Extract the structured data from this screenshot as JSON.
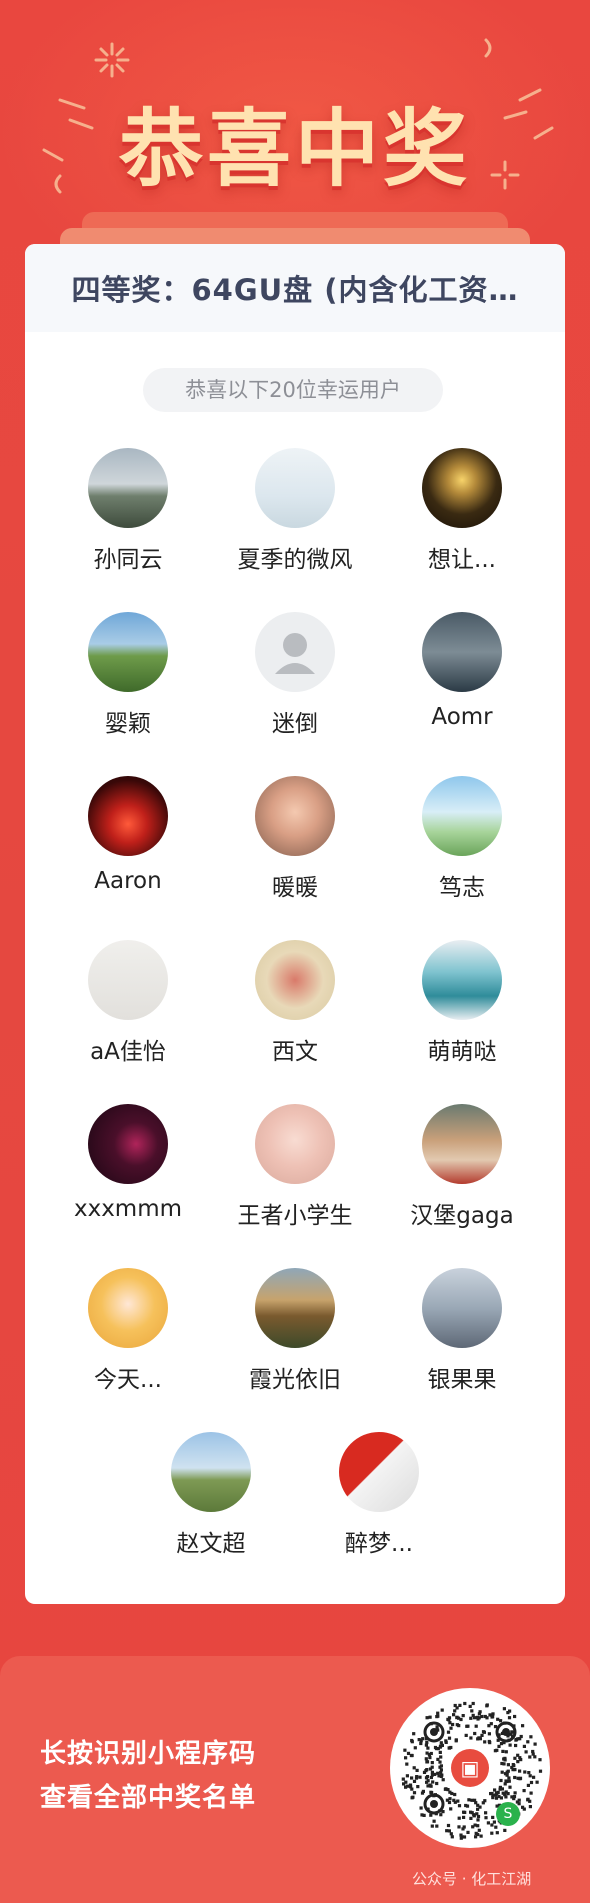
{
  "header": {
    "title": "恭喜中奖"
  },
  "card": {
    "prize": "四等奖：64GU盘 (内含化工资…",
    "subtitle": "恭喜以下20位幸运用户"
  },
  "winners": [
    {
      "name": "孙同云",
      "avatar": "landscape-hills"
    },
    {
      "name": "夏季的微风",
      "avatar": "pale-sky"
    },
    {
      "name": "想让...",
      "avatar": "dark-light"
    },
    {
      "name": "婴颖",
      "avatar": "field-person"
    },
    {
      "name": "迷倒",
      "avatar": "default-user"
    },
    {
      "name": "Aomr",
      "avatar": "ocean-sitting"
    },
    {
      "name": "Aaron",
      "avatar": "fireworks"
    },
    {
      "name": "暖暖",
      "avatar": "baby"
    },
    {
      "name": "笃志",
      "avatar": "anime-sky"
    },
    {
      "name": "aA佳怡",
      "avatar": "sketch-girl"
    },
    {
      "name": "西文",
      "avatar": "painting-figure"
    },
    {
      "name": "萌萌哒",
      "avatar": "anime-blue-hair"
    },
    {
      "name": "xxxmmm",
      "avatar": "dark-purple"
    },
    {
      "name": "王者小学生",
      "avatar": "baby-pink"
    },
    {
      "name": "汉堡gaga",
      "avatar": "pizza-shop"
    },
    {
      "name": "今天...",
      "avatar": "cartoon-girl"
    },
    {
      "name": "霞光依旧",
      "avatar": "mountain-sunset"
    },
    {
      "name": "银果果",
      "avatar": "anime-girl-sitting"
    },
    {
      "name": "赵文超",
      "avatar": "grassland"
    },
    {
      "name": "醉梦...",
      "avatar": "flag-man"
    }
  ],
  "footer": {
    "line1": "长按识别小程序码",
    "line2": "查看全部中奖名单",
    "watermark": "公众号 · 化工江湖"
  },
  "colors": {
    "background": "#e8453f",
    "title": "#ffe2b0",
    "footer": "#ec5a4f"
  }
}
